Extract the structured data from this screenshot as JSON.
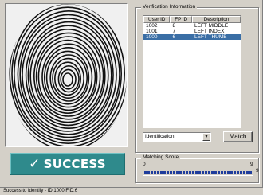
{
  "success_banner": {
    "check": "✓",
    "text": "SUCCESS"
  },
  "verification": {
    "title": "Verification Information",
    "columns": [
      "User ID",
      "FP ID",
      "Description"
    ],
    "rows": [
      {
        "user_id": "1002",
        "fp_id": "8",
        "description": "LEFT MIDDLE",
        "selected": false
      },
      {
        "user_id": "1001",
        "fp_id": "7",
        "description": "LEFT INDEX",
        "selected": false
      },
      {
        "user_id": "1000",
        "fp_id": "6",
        "description": "LEFT THUMB",
        "selected": true
      }
    ],
    "mode_select": {
      "value": "Identification"
    },
    "match_button": "Match"
  },
  "matching_score": {
    "title": "Matching Score",
    "min_label": "0",
    "max_label": "9",
    "value_label": "9",
    "level": 1.0
  },
  "status_bar": {
    "text": "Success to Identify  - ID:1000 FID:6"
  },
  "colors": {
    "success_bg": "#2f8a8c",
    "selection": "#3a6ea5",
    "progress": "#1f3d9c"
  }
}
